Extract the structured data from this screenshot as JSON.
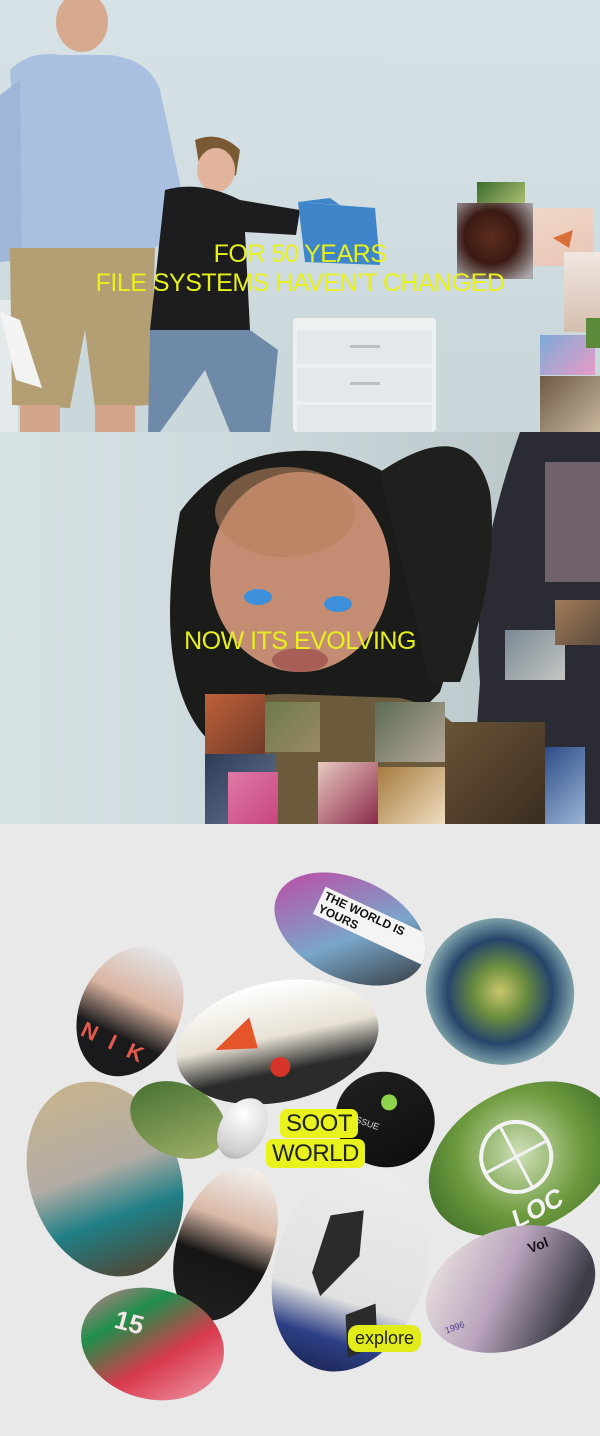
{
  "hero": {
    "line1": "FOR 50 YEARS",
    "line2": "FILE SYSTEMS HAVEN’T CHANGED"
  },
  "evolve": {
    "headline": "NOW ITS EVOLVING"
  },
  "explore_section": {
    "logo_line1": "SOOT",
    "logo_line2": "WORLD",
    "explore_label": "explore",
    "poster_text": "THE WORLD IS YOURS",
    "jacket_text": "N I K",
    "issue_text": "ISSUE",
    "globe_text": "LOC",
    "mag_text": "Vol",
    "mag_year": "1996",
    "red_poster_text": "15"
  },
  "colors": {
    "accent": "#e8f01b",
    "background": "#e9e9e9"
  }
}
